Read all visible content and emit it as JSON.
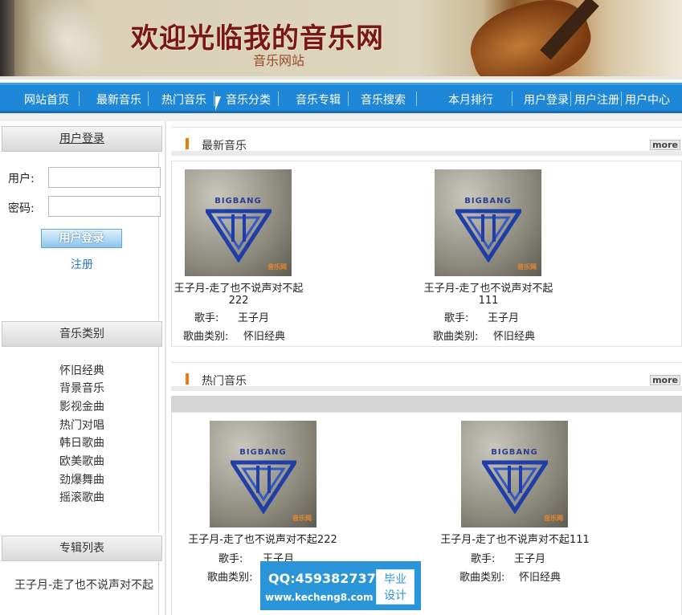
{
  "banner": {
    "title": "欢迎光临我的音乐网",
    "subtitle": "音乐网站"
  },
  "nav": {
    "items": [
      "网站首页",
      "最新音乐",
      "热门音乐",
      "音乐分类",
      "音乐专辑",
      "音乐搜索",
      "本月排行",
      "用户登录",
      "用户注册",
      "用户中心"
    ]
  },
  "sidebar": {
    "login": {
      "header": "用户登录",
      "user_label": "用户:",
      "password_label": "密码:",
      "user_value": "",
      "password_value": "",
      "login_button": "用户登录",
      "register_link": "注册"
    },
    "categories": {
      "header": "音乐类别",
      "items": [
        "怀旧经典",
        "背景音乐",
        "影视金曲",
        "热门对唱",
        "韩日歌曲",
        "欧美歌曲",
        "劲爆舞曲",
        "摇滚歌曲"
      ]
    },
    "albums": {
      "header": "专辑列表",
      "items": [
        "王子月-走了也不说声对不起"
      ]
    }
  },
  "latest": {
    "title": "最新音乐",
    "more": "more",
    "songs": [
      {
        "cover_text": "BIGBANG",
        "cover_logo": "音乐网",
        "title": "王子月-走了也不说声对不起222",
        "singer_label": "歌手:",
        "singer": "王子月",
        "category_label": "歌曲类别:",
        "category": "怀旧经典"
      },
      {
        "cover_text": "BIGBANG",
        "cover_logo": "音乐网",
        "title": "王子月-走了也不说声对不起111",
        "singer_label": "歌手:",
        "singer": "王子月",
        "category_label": "歌曲类别:",
        "category": "怀旧经典"
      }
    ]
  },
  "hot": {
    "title": "热门音乐",
    "more": "more",
    "songs": [
      {
        "cover_text": "BIGBANG",
        "cover_logo": "音乐网",
        "title": "王子月-走了也不说声对不起222",
        "singer_label": "歌手:",
        "singer": "王子月",
        "category_label": "歌曲类别:",
        "category": ""
      },
      {
        "cover_text": "BIGBANG",
        "cover_logo": "音乐网",
        "title": "王子月-走了也不说声对不起111",
        "singer_label": "歌手:",
        "singer": "王子月",
        "category_label": "歌曲类别:",
        "category": "怀旧经典"
      }
    ]
  },
  "watermark": {
    "qq": "QQ:459382737",
    "url": "www.kecheng8.com",
    "tag_line1": "毕业",
    "tag_line2": "设计"
  },
  "colors": {
    "nav_bg": "#1f87d8",
    "accent_bar": "#ee7b12",
    "link": "#2a78c0"
  }
}
